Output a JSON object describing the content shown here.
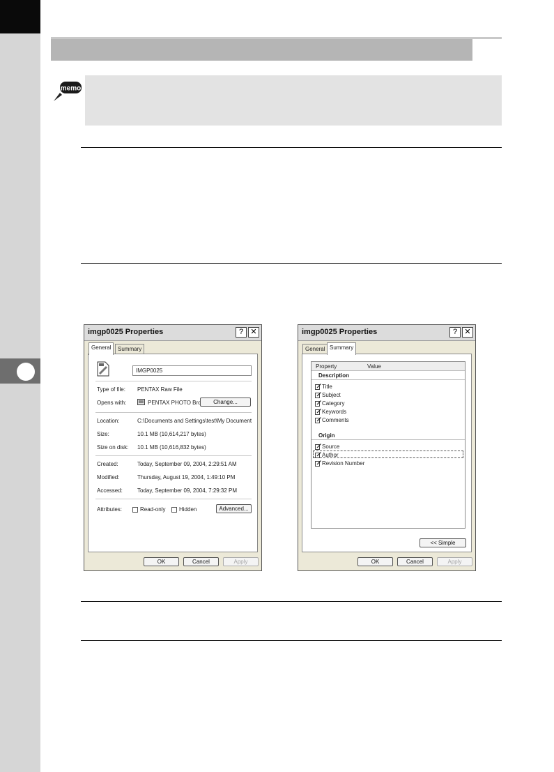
{
  "colors": {
    "strip": "#d6d6d6",
    "corner": "#0a0a0a",
    "heading_bar": "#b5b5b5",
    "memo_bg": "#e3e3e3",
    "dialog_bg": "#ece9d8"
  },
  "memo": {
    "icon_label": "memo"
  },
  "title_buttons": {
    "help": "?",
    "close": "✕"
  },
  "general_dialog": {
    "title": "imgp0025 Properties",
    "tabs": [
      "General",
      "Summary"
    ],
    "file_name": "IMGP0025",
    "type_label": "Type of file:",
    "type_value": "PENTAX Raw File",
    "opens_label": "Opens with:",
    "opens_value": "PENTAX PHOTO Brow:",
    "change_button": "Change...",
    "location_label": "Location:",
    "location_value": "C:\\Documents and Settings\\test\\My Documents\\m",
    "size_label": "Size:",
    "size_value": "10.1 MB (10,614,217 bytes)",
    "size_disk_label": "Size on disk:",
    "size_disk_value": "10.1 MB (10,616,832 bytes)",
    "created_label": "Created:",
    "created_value": "Today, September 09, 2004, 2:29:51 AM",
    "modified_label": "Modified:",
    "modified_value": "Thursday, August 19, 2004, 1:49:10 PM",
    "accessed_label": "Accessed:",
    "accessed_value": "Today, September 09, 2004, 7:29:32 PM",
    "attributes_label": "Attributes:",
    "readonly_label": "Read-only",
    "hidden_label": "Hidden",
    "advanced_button": "Advanced...",
    "ok": "OK",
    "cancel": "Cancel",
    "apply": "Apply"
  },
  "summary_dialog": {
    "title": "imgp0025 Properties",
    "tabs": [
      "General",
      "Summary"
    ],
    "col_property": "Property",
    "col_value": "Value",
    "description_heading": "Description",
    "description_items": [
      "Title",
      "Subject",
      "Category",
      "Keywords",
      "Comments"
    ],
    "origin_heading": "Origin",
    "origin_items": [
      "Source",
      "Author",
      "Revision Number"
    ],
    "simple_button": "<< Simple",
    "ok": "OK",
    "cancel": "Cancel",
    "apply": "Apply"
  }
}
